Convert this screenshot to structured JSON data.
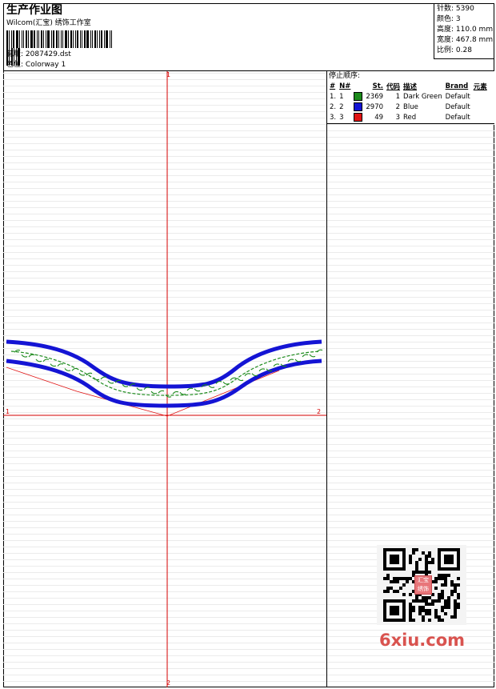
{
  "header": {
    "title": "生产作业图",
    "subtitle": "Wilcom(汇宝) 绣饰工作室",
    "file_label": "花版:",
    "file_value": "2087429.dst",
    "colorway_label": "色位:",
    "colorway_value": "Colorway 1"
  },
  "stats": {
    "stitches_label": "针数:",
    "stitches_value": "5390",
    "colors_label": "颜色:",
    "colors_value": "3",
    "height_label": "高度:",
    "height_value": "110.0 mm",
    "width_label": "宽度:",
    "width_value": "467.8 mm",
    "scale_label": "比例:",
    "scale_value": "0.28"
  },
  "axes": {
    "v_top": "1",
    "v_bottom": "2",
    "h_left": "1",
    "h_right": "2"
  },
  "sequence": {
    "title": "停止顺序:",
    "headers": {
      "index": "#",
      "no": "N#",
      "stitches": "St.",
      "code": "代码",
      "desc": "描述",
      "brand": "Brand",
      "element": "元素"
    },
    "rows": [
      {
        "index": "1.",
        "no": "1",
        "color": "#1c8a1c",
        "stitches": "2369",
        "code": "1",
        "desc": "Dark Green",
        "brand": "Default"
      },
      {
        "index": "2.",
        "no": "2",
        "color": "#1414d4",
        "stitches": "2970",
        "code": "2",
        "desc": "Blue",
        "brand": "Default"
      },
      {
        "index": "3.",
        "no": "3",
        "color": "#e01414",
        "stitches": "49",
        "code": "3",
        "desc": "Red",
        "brand": "Default"
      }
    ]
  },
  "qr": {
    "seal_text": "汇宝绣饰"
  },
  "watermark": {
    "text": "6xiu.com"
  },
  "colors": {
    "axis": "#d40000",
    "blue": "#1414d4",
    "green": "#1c8a1c",
    "red": "#e01414"
  }
}
